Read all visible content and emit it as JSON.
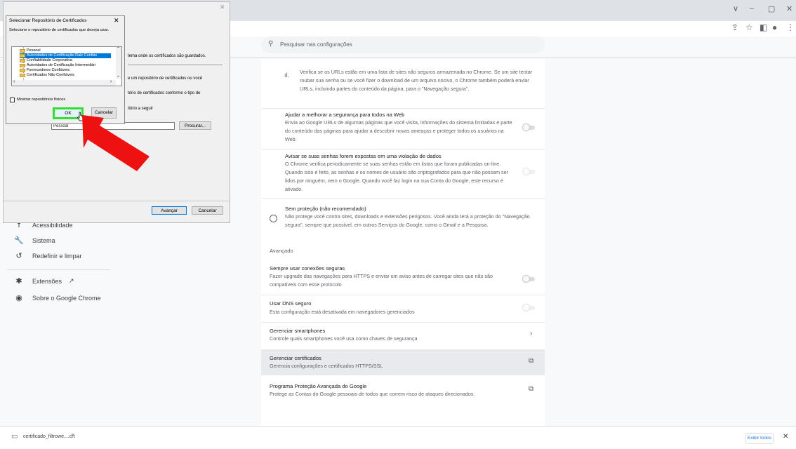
{
  "browser": {
    "window_controls": [
      "∨",
      "–",
      "▢",
      "✕"
    ]
  },
  "settings": {
    "search_placeholder": "Pesquisar nas configurações",
    "sidebar": [
      {
        "label": "Acessibilidade",
        "icon": "accessibility-icon"
      },
      {
        "label": "Sistema",
        "icon": "wrench-icon"
      },
      {
        "label": "Redefinir e limpar",
        "icon": "reset-icon"
      },
      {
        "label": "Extensões",
        "icon": "puzzle-icon"
      },
      {
        "label": "Sobre o Google Chrome",
        "icon": "chrome-icon"
      }
    ],
    "safe_browsing": {
      "p1": "Verifica se os URLs estão em uma lista de sites não seguros armazenada no Chrome. Se um site tentar roubar sua senha ou se você fizer o download de um arquivo nocivo, o Chrome também poderá enviar URLs, incluindo partes do conteúdo da página, para o \"Navegação segura\".",
      "help_title": "Ajudar a melhorar a segurança para todos na Web",
      "help_desc": "Envia ao Google URLs de algumas páginas que você visita, informações do sistema limitadas e parte do conteúdo das páginas para ajudar a descobrir novas ameaças e proteger todos os usuários na Web.",
      "warn_title": "Avisar se suas senhas forem expostas em uma violação de dados",
      "warn_desc": "O Chrome verifica periodicamente se suas senhas estão em listas que foram publicadas on-line. Quando isso é feito, as senhas e os nomes de usuário são criptografados para que não possam ser lidos por ninguém, nem o Google. Quando você faz login na sua Conta do Google, este recurso é ativado.",
      "noprot_title": "Sem proteção (não recomendado)",
      "noprot_desc": "Não protege você contra sites, downloads e extensões perigosos. Você ainda terá a proteção do \"Navegação segura\", sempre que possível, em outros Serviços do Google, como o Gmail e a Pesquisa."
    },
    "advanced": {
      "heading": "Avançado",
      "https_title": "Sempre usar conexões seguras",
      "https_desc": "Fazer upgrade das navegações para HTTPS e enviar um aviso antes de carregar sites que não são compatíveis com esse protocolo",
      "dns_title": "Usar DNS seguro",
      "dns_desc": "Esta configuração está desativada em navegadores gerenciados",
      "phones_title": "Gerenciar smartphones",
      "phones_desc": "Controle quais smartphones você usa como chaves de segurança",
      "certs_title": "Gerenciar certificados",
      "certs_desc": "Gerencia configurações e certificados HTTPS/SSL",
      "adv_title": "Programa Proteção Avançada do Google",
      "adv_desc": "Protege as Contas do Google pessoais de todos que correm risco de ataques direcionados."
    }
  },
  "wizard": {
    "line1": "tema onde os certificados são guardados.",
    "line2": "e um repositório de certificados ou você",
    "line3": "tório de certificados conforme o tipo de",
    "line4": "itório a seguir",
    "store_value": "Pessoal",
    "browse": "Procurar...",
    "next": "Avançar",
    "cancel": "Cancelar"
  },
  "dialog": {
    "title": "Selecionar Repositório de Certificados",
    "description": "Selecione o repositório de certificados que deseja usar.",
    "stores": [
      "Pessoal",
      "Autoridades de Certificação Raiz Confiáv",
      "Confiabilidade Corporativa",
      "Autoridades de Certificação Intermediári",
      "Fornecedores Confiáveis",
      "Certificados Não Confiáveis"
    ],
    "selected_index": 1,
    "show_physical": "Mostrar repositórios físicos",
    "ok": "OK",
    "cancel": "Cancelar"
  },
  "downloads": {
    "file": "certificado_filtrowe....crt",
    "show_all": "Exibir todos"
  },
  "colors": {
    "highlight_green": "#2fe033",
    "annotation_red": "#ee1111",
    "selection_blue": "#0078d7"
  }
}
